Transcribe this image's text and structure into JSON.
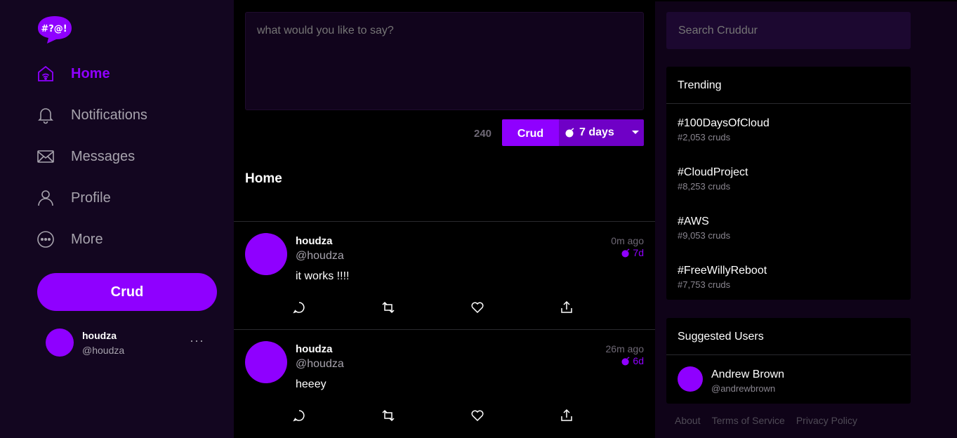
{
  "colors": {
    "accent": "#8f00ff",
    "accent_dark": "#6f00c6",
    "background": "#0f0318",
    "sidebar_bg": "#130620",
    "main_bg": "#000000",
    "muted_text": "#a7a3ad"
  },
  "logo": {
    "text": "#?@!",
    "icon": "speech-bubble-logo"
  },
  "sidebar": {
    "nav": [
      {
        "label": "Home",
        "icon": "home-icon",
        "active": true
      },
      {
        "label": "Notifications",
        "icon": "bell-icon",
        "active": false
      },
      {
        "label": "Messages",
        "icon": "mail-icon",
        "active": false
      },
      {
        "label": "Profile",
        "icon": "user-icon",
        "active": false
      },
      {
        "label": "More",
        "icon": "more-circle-icon",
        "active": false
      }
    ],
    "crud_button": "Crud",
    "profile": {
      "name": "houdza",
      "handle": "@houdza",
      "more": "···"
    }
  },
  "compose": {
    "placeholder": "what would you like to say?",
    "char_count": "240",
    "crud_button": "Crud",
    "ttl_label": "7 days"
  },
  "main": {
    "heading": "Home",
    "posts": [
      {
        "name": "houdza",
        "handle": "@houdza",
        "time": "0m ago",
        "ttl": "7d",
        "body": "it works !!!!"
      },
      {
        "name": "houdza",
        "handle": "@houdza",
        "time": "26m ago",
        "ttl": "6d",
        "body": "heeey"
      }
    ]
  },
  "right": {
    "search_placeholder": "Search Cruddur",
    "trending_title": "Trending",
    "trends": [
      {
        "tag": "#100DaysOfCloud",
        "count": "#2,053 cruds"
      },
      {
        "tag": "#CloudProject",
        "count": "#8,253 cruds"
      },
      {
        "tag": "#AWS",
        "count": "#9,053 cruds"
      },
      {
        "tag": "#FreeWillyReboot",
        "count": "#7,753 cruds"
      }
    ],
    "suggested_title": "Suggested Users",
    "suggested": [
      {
        "name": "Andrew Brown",
        "handle": "@andrewbrown"
      }
    ],
    "footer": [
      "About",
      "Terms of Service",
      "Privacy Policy"
    ]
  }
}
